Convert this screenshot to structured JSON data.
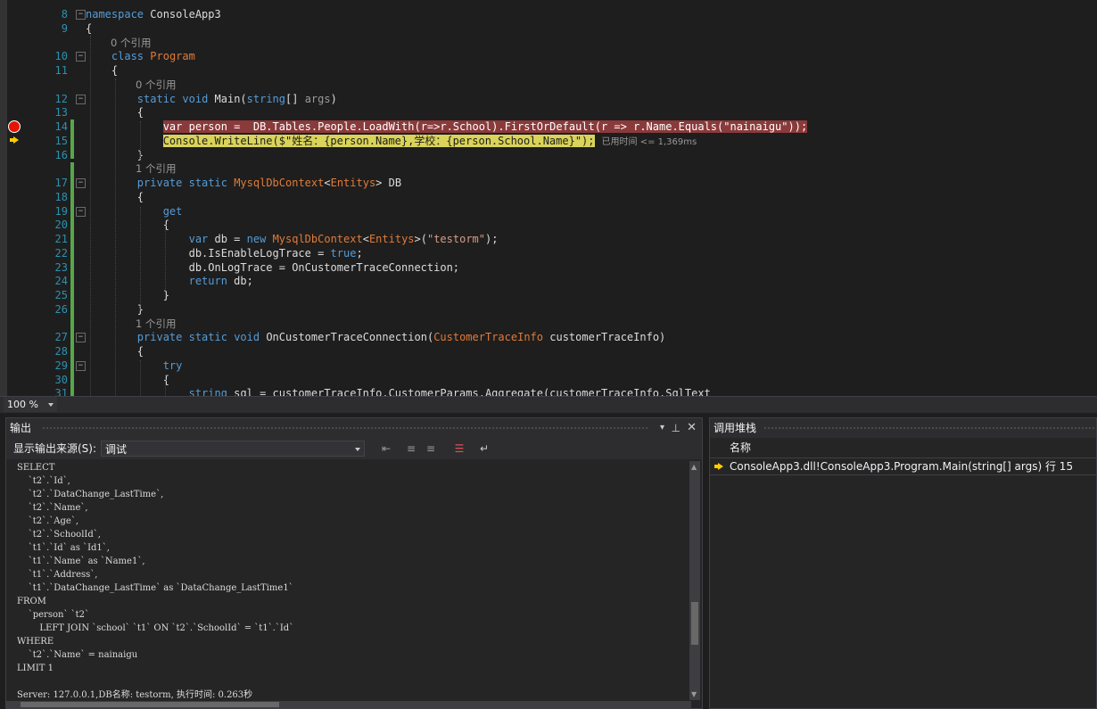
{
  "editor": {
    "lines": [
      {
        "num": "8",
        "segs": [
          {
            "t": "namespace",
            "c": "kw"
          },
          {
            "t": " ConsoleApp3"
          }
        ]
      },
      {
        "num": "9",
        "segs": [
          {
            "t": "{"
          }
        ]
      },
      {
        "num": "",
        "hint": "0 个引用",
        "indent": 28
      },
      {
        "num": "10",
        "segs": [
          {
            "t": "    "
          },
          {
            "t": "class",
            "c": "kw"
          },
          {
            "t": " "
          },
          {
            "t": "Program",
            "c": "ty"
          }
        ]
      },
      {
        "num": "11",
        "segs": [
          {
            "t": "    {"
          }
        ]
      },
      {
        "num": "",
        "hint": "0 个引用",
        "indent": 56
      },
      {
        "num": "12",
        "segs": [
          {
            "t": "        "
          },
          {
            "t": "static",
            "c": "kw"
          },
          {
            "t": " "
          },
          {
            "t": "void",
            "c": "kw"
          },
          {
            "t": " Main("
          },
          {
            "t": "string",
            "c": "kw"
          },
          {
            "t": "[] "
          },
          {
            "t": "args",
            "c": "param"
          },
          {
            "t": ")"
          }
        ]
      },
      {
        "num": "13",
        "segs": [
          {
            "t": "        {"
          }
        ]
      },
      {
        "num": "14",
        "segs": [
          {
            "t": "            "
          },
          {
            "t": "var person =  DB.Tables.People.LoadWith(r=>r.School).FirstOrDefault(r => r.Name.Equals(\"nainaigu\"));",
            "c": "bp-hl"
          }
        ]
      },
      {
        "num": "15",
        "segs": [
          {
            "t": "            "
          },
          {
            "t": "Console.WriteLine($\"姓名：{person.Name},学校：{person.School.Name}\");",
            "c": "cur-hl"
          }
        ],
        "elapsed": "已用时间 <= 1,369ms"
      },
      {
        "num": "16",
        "segs": [
          {
            "t": "        }"
          }
        ]
      },
      {
        "num": "",
        "hint": "1 个引用",
        "indent": 56
      },
      {
        "num": "17",
        "segs": [
          {
            "t": "        "
          },
          {
            "t": "private",
            "c": "kw"
          },
          {
            "t": " "
          },
          {
            "t": "static",
            "c": "kw"
          },
          {
            "t": " "
          },
          {
            "t": "MysqlDbContext",
            "c": "ty"
          },
          {
            "t": "<"
          },
          {
            "t": "Entitys",
            "c": "ty"
          },
          {
            "t": "> DB"
          }
        ]
      },
      {
        "num": "18",
        "segs": [
          {
            "t": "        {"
          }
        ]
      },
      {
        "num": "19",
        "segs": [
          {
            "t": "            "
          },
          {
            "t": "get",
            "c": "kw"
          }
        ]
      },
      {
        "num": "20",
        "segs": [
          {
            "t": "            {"
          }
        ]
      },
      {
        "num": "21",
        "segs": [
          {
            "t": "                "
          },
          {
            "t": "var",
            "c": "kw"
          },
          {
            "t": " db = "
          },
          {
            "t": "new",
            "c": "kw"
          },
          {
            "t": " "
          },
          {
            "t": "MysqlDbContext",
            "c": "ty"
          },
          {
            "t": "<"
          },
          {
            "t": "Entitys",
            "c": "ty"
          },
          {
            "t": ">("
          },
          {
            "t": "\"testorm\"",
            "c": "str"
          },
          {
            "t": ");"
          }
        ]
      },
      {
        "num": "22",
        "segs": [
          {
            "t": "                db.IsEnableLogTrace = "
          },
          {
            "t": "true",
            "c": "kw"
          },
          {
            "t": ";"
          }
        ]
      },
      {
        "num": "23",
        "segs": [
          {
            "t": "                db.OnLogTrace = OnCustomerTraceConnection;"
          }
        ]
      },
      {
        "num": "24",
        "segs": [
          {
            "t": "                "
          },
          {
            "t": "return",
            "c": "kw"
          },
          {
            "t": " db;"
          }
        ]
      },
      {
        "num": "25",
        "segs": [
          {
            "t": "            }"
          }
        ]
      },
      {
        "num": "26",
        "segs": [
          {
            "t": "        }"
          }
        ]
      },
      {
        "num": "",
        "hint": "1 个引用",
        "indent": 56
      },
      {
        "num": "27",
        "segs": [
          {
            "t": "        "
          },
          {
            "t": "private",
            "c": "kw"
          },
          {
            "t": " "
          },
          {
            "t": "static",
            "c": "kw"
          },
          {
            "t": " "
          },
          {
            "t": "void",
            "c": "kw"
          },
          {
            "t": " OnCustomerTraceConnection("
          },
          {
            "t": "CustomerTraceInfo",
            "c": "ty"
          },
          {
            "t": " customerTraceInfo)"
          }
        ]
      },
      {
        "num": "28",
        "segs": [
          {
            "t": "        {"
          }
        ]
      },
      {
        "num": "29",
        "segs": [
          {
            "t": "            "
          },
          {
            "t": "try",
            "c": "kw"
          }
        ]
      },
      {
        "num": "30",
        "segs": [
          {
            "t": "            {"
          }
        ]
      },
      {
        "num": "31",
        "segs": [
          {
            "t": "                "
          },
          {
            "t": "string",
            "c": "kw"
          },
          {
            "t": " sql = customerTraceInfo.CustomerParams.Aggregate(customerTraceInfo.SqlText"
          }
        ]
      }
    ]
  },
  "zoom": "100 %",
  "output": {
    "title": "输出",
    "source_label": "显示输出来源(S):",
    "source_value": "调试",
    "lines": [
      "SELECT",
      "    `t2`.`Id`,",
      "    `t2`.`DataChange_LastTime`,",
      "    `t2`.`Name`,",
      "    `t2`.`Age`,",
      "    `t2`.`SchoolId`,",
      "    `t1`.`Id` as `Id1`,",
      "    `t1`.`Name` as `Name1`,",
      "    `t1`.`Address`,",
      "    `t1`.`DataChange_LastTime` as `DataChange_LastTime1`",
      "FROM",
      "    `person` `t2`",
      "        LEFT JOIN `school` `t1` ON `t2`.`SchoolId` = `t1`.`Id`",
      "WHERE",
      "    `t2`.`Name` = nainaigu",
      "LIMIT 1",
      "",
      "Server: 127.0.0.1,DB名称: testorm, 执行时间: 0.263秒"
    ]
  },
  "callstack": {
    "title": "调用堆栈",
    "col_name": "名称",
    "frame": "ConsoleApp3.dll!ConsoleApp3.Program.Main(string[] args) 行 15"
  },
  "colors": {
    "breakpoint": "#e51400",
    "breakpoint_line": "#8a3a3a",
    "current_line": "#d9d35a",
    "keyword": "#569cd6",
    "type": "#e07b39"
  }
}
